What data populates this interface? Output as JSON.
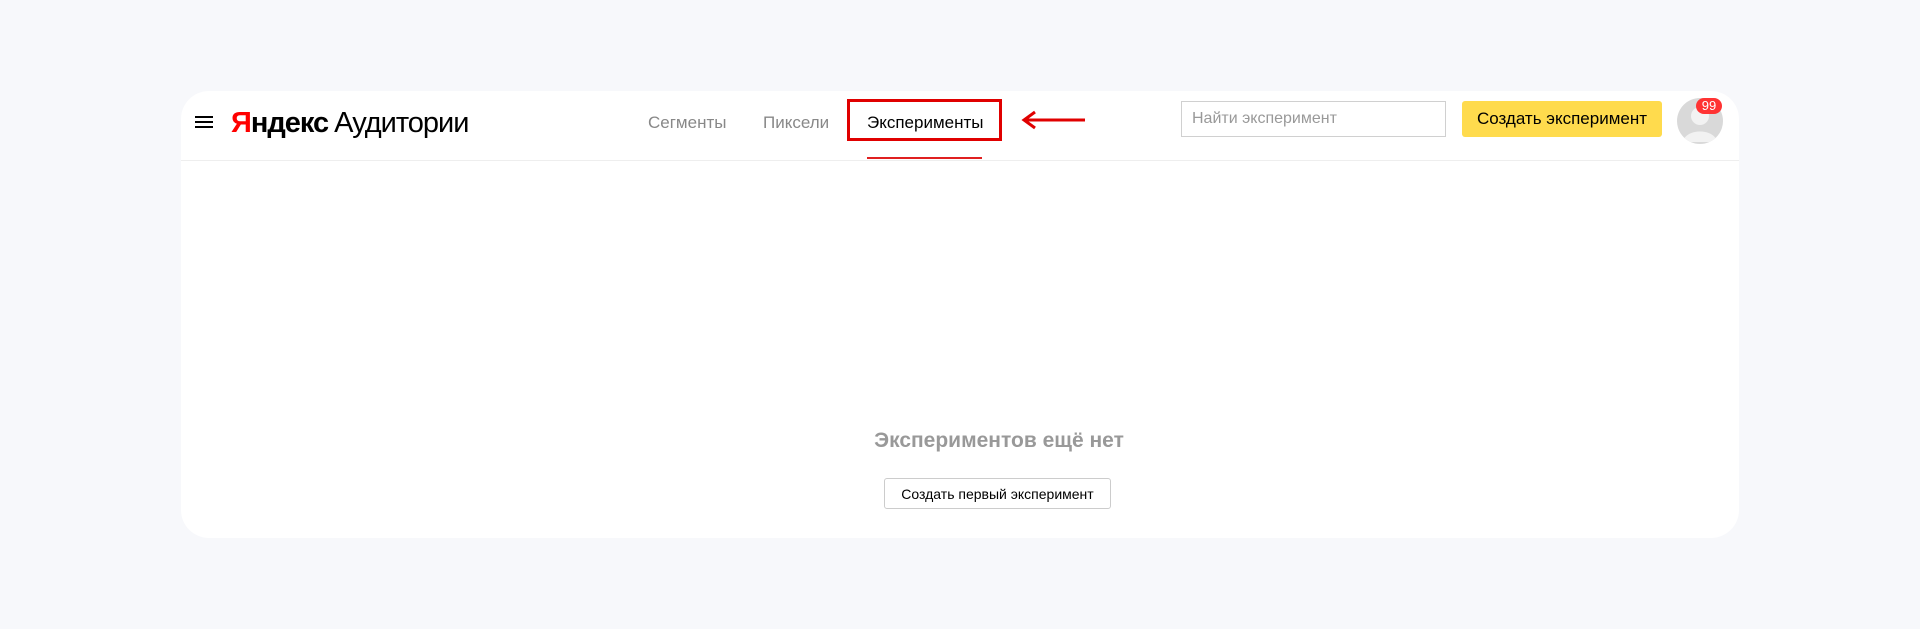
{
  "logo": {
    "brand_first": "Я",
    "brand_rest": "ндекс",
    "product": "Аудитории"
  },
  "nav": {
    "segments": "Сегменты",
    "pixels": "Пиксели",
    "experiments": "Эксперименты"
  },
  "search": {
    "placeholder": "Найти эксперимент"
  },
  "actions": {
    "create_label": "Создать эксперимент"
  },
  "user": {
    "badge_count": "99"
  },
  "empty_state": {
    "title": "Экспериментов ещё нет",
    "button_label": "Создать первый эксперимент"
  },
  "colors": {
    "accent_yellow": "#ffdb4d",
    "annotation_red": "#e00000",
    "badge_red": "#ff3333"
  }
}
